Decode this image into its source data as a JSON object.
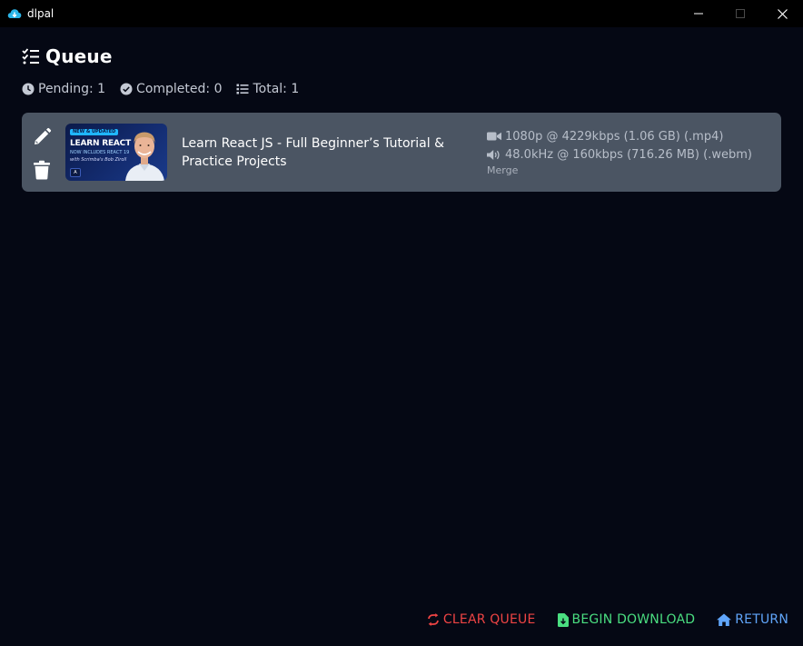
{
  "window": {
    "title": "dlpal",
    "controls": [
      "minimize-icon",
      "maximize-icon",
      "close-icon"
    ]
  },
  "page": {
    "heading": "Queue",
    "heading_icon": "list-check-icon"
  },
  "stats": {
    "pending": "Pending: 1",
    "completed": "Completed: 0",
    "total": "Total: 1"
  },
  "queue": [
    {
      "title": "Learn React JS - Full Beginner’s Tutorial & Practice Projects",
      "thumbnail": {
        "badge": "NEW & UPDATED",
        "headline": "LEARN REACT",
        "subline": "NOW INCLUDES REACT 19",
        "author": "with Scrimba's Bob Ziroll",
        "logo": "A"
      },
      "video_format": "1080p @ 4229kbps (1.06 GB) (.mp4)",
      "audio_format": "48.0kHz @ 160kbps (716.26 MB) (.webm)",
      "mode": "Merge",
      "actions": [
        "pencil-icon",
        "trash-icon"
      ]
    }
  ],
  "footer": {
    "clear": "CLEAR QUEUE",
    "begin": "BEGIN DOWNLOAD",
    "return": "RETURN"
  },
  "colors": {
    "background": "#050814",
    "card": "#4b5563",
    "clear": "#ef4444",
    "begin": "#4ade80",
    "return": "#60a5fa"
  }
}
